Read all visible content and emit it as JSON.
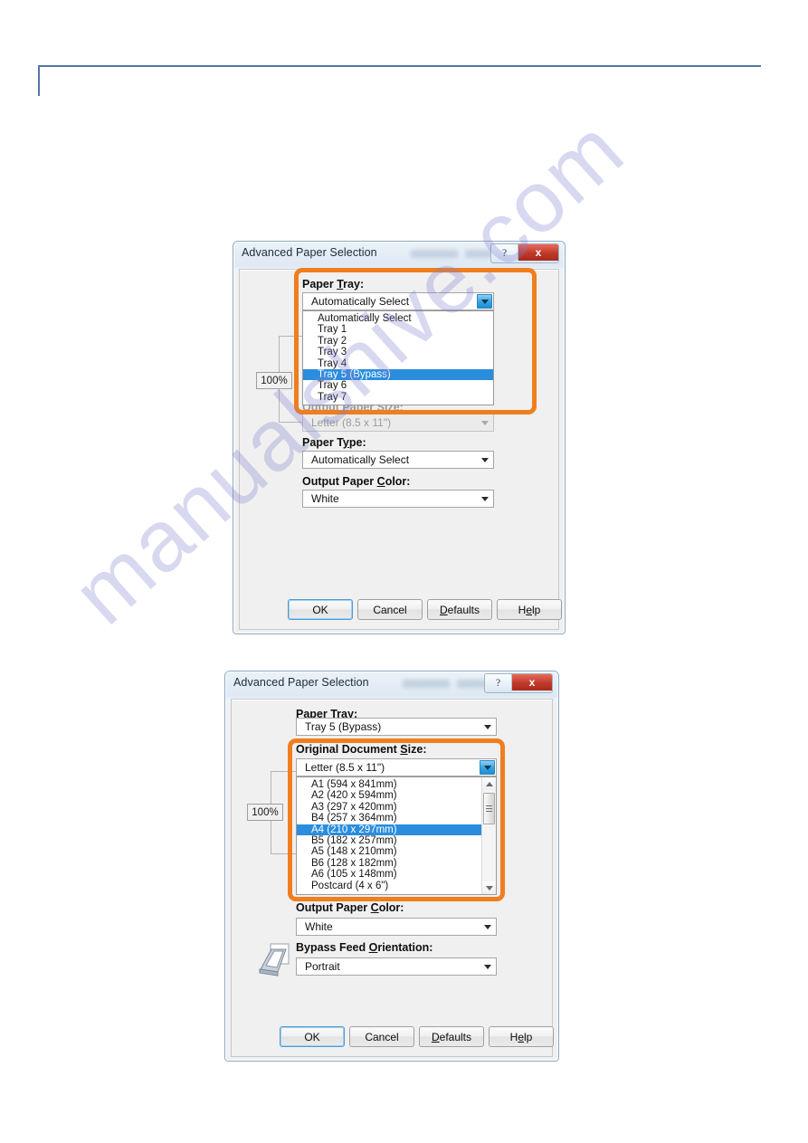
{
  "page": {
    "watermark": "manualshive.com",
    "accent_orange": "#f07e1e",
    "header_rule_color": "#5478a6",
    "selection_blue": "#2a8dde"
  },
  "dialog1": {
    "title": "Advanced Paper Selection",
    "caption": {
      "help_label": "?",
      "close_label": "x"
    },
    "preview": {
      "zoom_label": "100%"
    },
    "fields": {
      "paper_tray": {
        "label_pre": "Paper ",
        "label_accel": "T",
        "label_post": "ray:",
        "value": "Automatically Select",
        "options": [
          "Automatically Select",
          "Tray 1",
          "Tray 2",
          "Tray 3",
          "Tray 4",
          "Tray 5 (Bypass)",
          "Tray 6",
          "Tray 7"
        ],
        "selected_index": 5
      },
      "output_paper_size": {
        "label_pre": "Output Paper ",
        "label_accel": "S",
        "label_post": "ize:",
        "value": "Letter (8.5 x 11\")"
      },
      "paper_type": {
        "label_pre": "Paper T",
        "label_accel": "y",
        "label_post": "pe:",
        "value": "Automatically Select"
      },
      "output_paper_color": {
        "label_pre": "Output Paper ",
        "label_accel": "C",
        "label_post": "olor:",
        "value": "White"
      }
    },
    "buttons": {
      "ok": "OK",
      "cancel": "Cancel",
      "defaults_pre": "",
      "defaults_accel": "D",
      "defaults_post": "efaults",
      "help_pre": "H",
      "help_accel": "e",
      "help_post": "lp"
    }
  },
  "dialog2": {
    "title": "Advanced Paper Selection",
    "caption": {
      "help_label": "?",
      "close_label": "x"
    },
    "preview": {
      "zoom_label": "100%"
    },
    "fields": {
      "paper_tray": {
        "label_pre": "Paper ",
        "label_accel": "T",
        "label_post": "ray:",
        "value": "Tray 5 (Bypass)"
      },
      "original_document_size": {
        "label_pre": "Original Document ",
        "label_accel": "S",
        "label_post": "ize:",
        "value": "Letter (8.5 x 11\")",
        "options": [
          "A1 (594 x 841mm)",
          "A2 (420 x 594mm)",
          "A3 (297 x 420mm)",
          "B4 (257 x 364mm)",
          "A4 (210 x 297mm)",
          "B5 (182 x 257mm)",
          "A5 (148 x 210mm)",
          "B6 (128 x 182mm)",
          "A6 (105 x 148mm)",
          "Postcard (4 x 6\")"
        ],
        "selected_index": 4
      },
      "output_paper_color": {
        "label_pre": "Output Paper ",
        "label_accel": "C",
        "label_post": "olor:",
        "value": "White"
      },
      "bypass_feed_orientation": {
        "label_pre": "Bypass Feed ",
        "label_accel": "O",
        "label_post": "rientation:",
        "value": "Portrait",
        "icon": "paper-tray-icon"
      }
    },
    "buttons": {
      "ok": "OK",
      "cancel": "Cancel",
      "defaults_pre": "",
      "defaults_accel": "D",
      "defaults_post": "efaults",
      "help_pre": "H",
      "help_accel": "e",
      "help_post": "lp"
    }
  }
}
